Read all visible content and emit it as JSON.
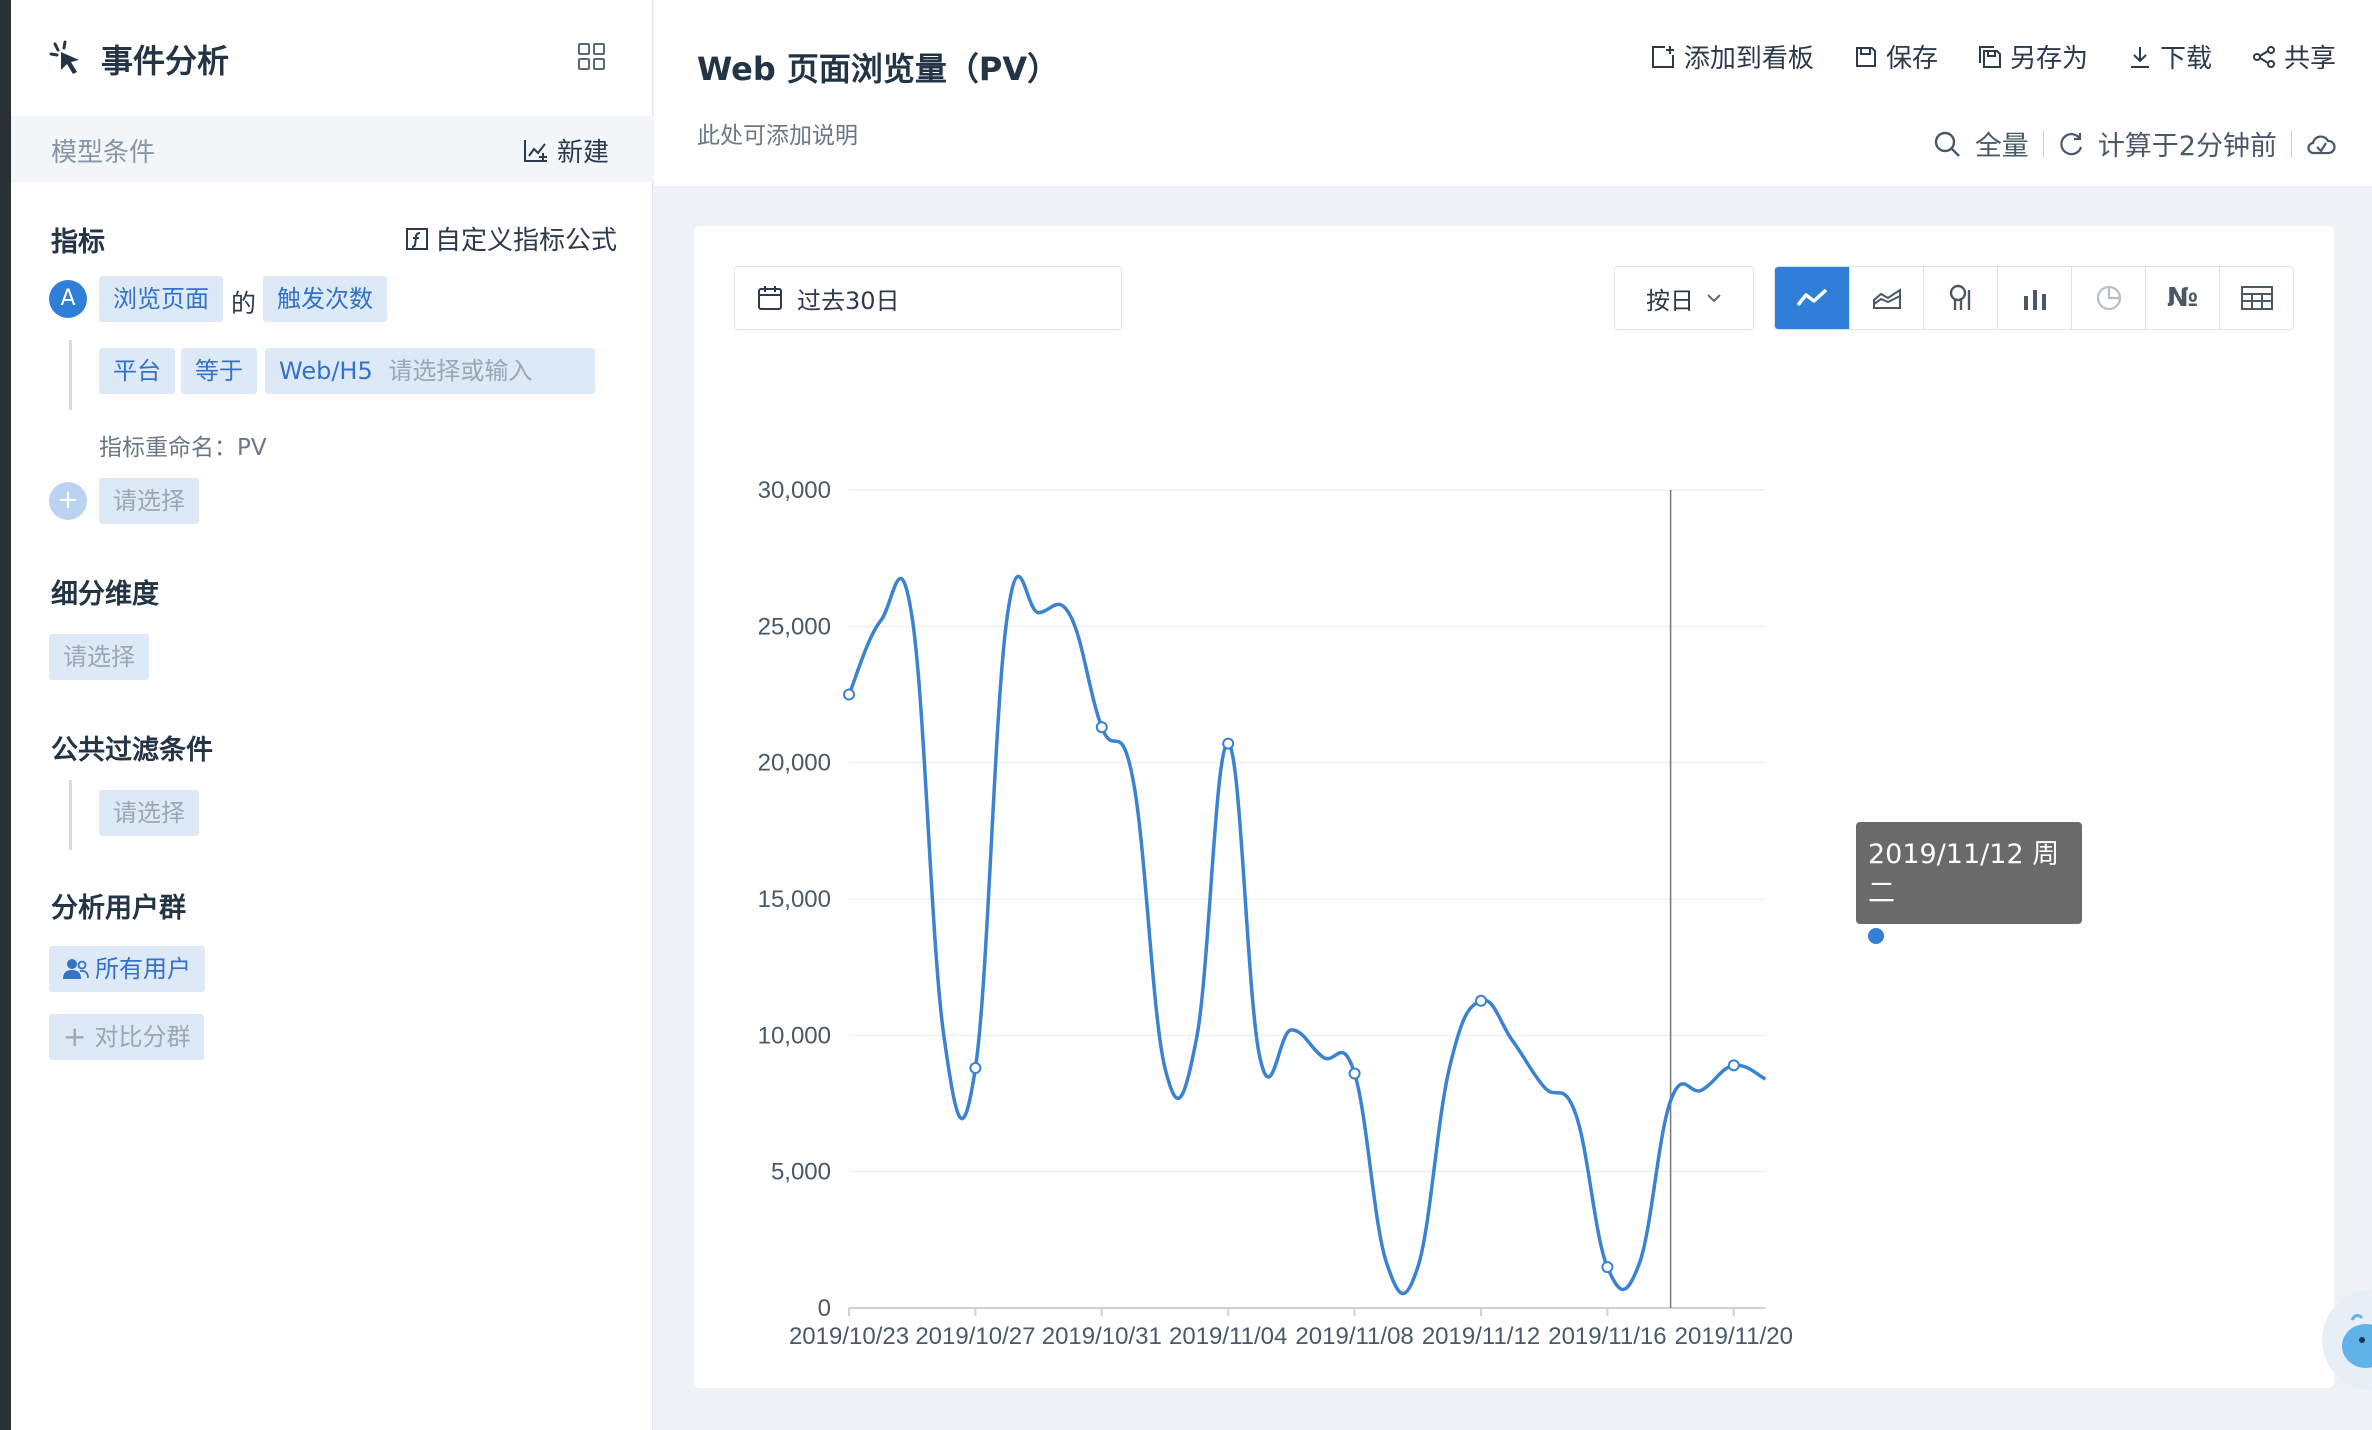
{
  "sidebar": {
    "title": "事件分析",
    "model_label": "模型条件",
    "new_label": "新建",
    "metric_title": "指标",
    "custom_formula": "自定义指标公式",
    "metric_letter": "A",
    "event": "浏览页面",
    "of": "的",
    "measure": "触发次数",
    "filter_prop": "平台",
    "filter_op": "等于",
    "filter_value": "Web/H5",
    "filter_placeholder": "请选择或输入",
    "rename": "指标重命名：PV",
    "select_placeholder": "请选择",
    "dimension_title": "细分维度",
    "dimension_placeholder": "请选择",
    "public_filter_title": "公共过滤条件",
    "public_filter_placeholder": "请选择",
    "user_group_title": "分析用户群",
    "all_users": "所有用户",
    "compare_group": "对比分群"
  },
  "header": {
    "title": "Web 页面浏览量（PV）",
    "description": "此处可添加说明",
    "actions": [
      "添加到看板",
      "保存",
      "另存为",
      "下载",
      "共享"
    ],
    "scope": "全量",
    "computed": "计算于2分钟前"
  },
  "controls": {
    "date_range": "过去30日",
    "granularity": "按日"
  },
  "tooltip": {
    "date": "2019/11/12 周二",
    "label": "PV：11,267"
  },
  "colors": {
    "accent": "#2f7ed8",
    "line": "#3b82d0"
  },
  "chart_data": {
    "type": "line",
    "ylim": [
      0,
      30000
    ],
    "yticks": [
      0,
      5000,
      10000,
      15000,
      20000,
      25000,
      30000
    ],
    "ytick_labels": [
      "0",
      "5,000",
      "10,000",
      "15,000",
      "20,000",
      "25,000",
      "30,000"
    ],
    "xtick_labels": [
      "2019/10/23",
      "2019/10/27",
      "2019/10/31",
      "2019/11/04",
      "2019/11/08",
      "2019/11/12",
      "2019/11/16",
      "2019/11/20"
    ],
    "x": [
      "2019/10/23",
      "2019/10/24",
      "2019/10/25",
      "2019/10/26",
      "2019/10/27",
      "2019/10/28",
      "2019/10/29",
      "2019/10/30",
      "2019/10/31",
      "2019/11/01",
      "2019/11/02",
      "2019/11/03",
      "2019/11/04",
      "2019/11/05",
      "2019/11/06",
      "2019/11/07",
      "2019/11/08",
      "2019/11/09",
      "2019/11/10",
      "2019/11/11",
      "2019/11/12",
      "2019/11/13",
      "2019/11/14",
      "2019/11/15",
      "2019/11/16",
      "2019/11/17",
      "2019/11/18",
      "2019/11/19",
      "2019/11/20",
      "2019/11/21"
    ],
    "series": [
      {
        "name": "PV",
        "values": [
          22500,
          25200,
          25300,
          10000,
          8800,
          25300,
          25500,
          25400,
          21300,
          19300,
          8800,
          9900,
          20700,
          9200,
          10200,
          9200,
          8600,
          1700,
          1500,
          8800,
          11267,
          9800,
          8100,
          7100,
          1500,
          1600,
          7600,
          8000,
          8900,
          8400
        ]
      }
    ],
    "crosshair_x": "2019/11/18",
    "marked_points": [
      "2019/10/23",
      "2019/10/27",
      "2019/10/31",
      "2019/11/04",
      "2019/11/08",
      "2019/11/12",
      "2019/11/16",
      "2019/11/20"
    ]
  }
}
